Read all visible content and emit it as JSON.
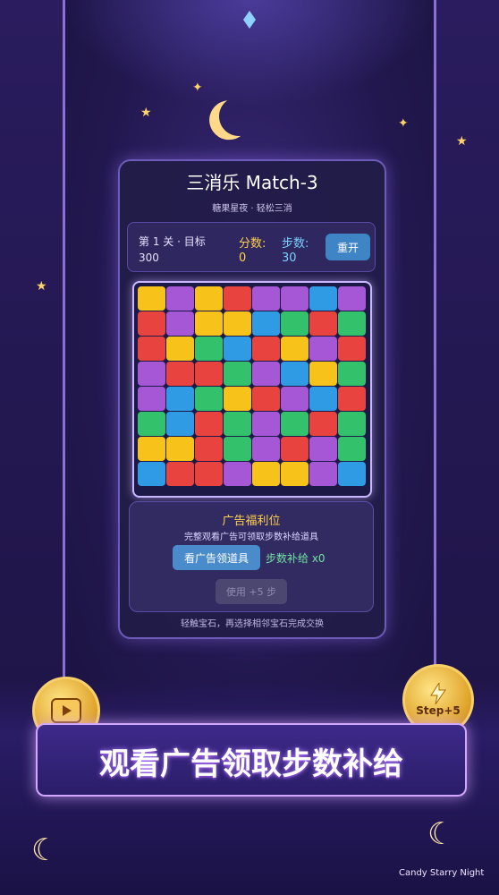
{
  "game": {
    "title": "三消乐 Match-3",
    "subtitle": "糖果星夜 · 轻松三消",
    "level_line1": "第 1 关 · 目标",
    "level_line2": "300",
    "score_label": "分数:",
    "score_value": "0",
    "steps_label": "步数:",
    "steps_value": "30",
    "restart_label": "重开",
    "hint": "轻触宝石，再选择相邻宝石完成交换"
  },
  "ad": {
    "title": "广告福利位",
    "desc": "完整观看广告可领取步数补给道具",
    "watch_button": "看广告领道具",
    "supply_text": "步数补给 x0",
    "use_button": "使用 +5 步"
  },
  "promo": {
    "banner_text": "观看广告领取步数补给",
    "coin_right_label": "Step+5",
    "brand": "Candy Starry Night"
  },
  "colors": {
    "Y": "#f7c21a",
    "P": "#a657d6",
    "R": "#e8433e",
    "B": "#2f9be5",
    "G": "#33c26b"
  },
  "board": [
    [
      "Y",
      "P",
      "Y",
      "R",
      "P",
      "P",
      "B",
      "P"
    ],
    [
      "R",
      "P",
      "Y",
      "Y",
      "B",
      "G",
      "R",
      "G"
    ],
    [
      "R",
      "Y",
      "G",
      "B",
      "R",
      "Y",
      "P",
      "R"
    ],
    [
      "P",
      "R",
      "R",
      "G",
      "P",
      "B",
      "Y",
      "G"
    ],
    [
      "P",
      "B",
      "G",
      "Y",
      "R",
      "P",
      "B",
      "R"
    ],
    [
      "G",
      "B",
      "R",
      "G",
      "P",
      "G",
      "R",
      "G"
    ],
    [
      "Y",
      "Y",
      "R",
      "G",
      "P",
      "R",
      "P",
      "G"
    ],
    [
      "B",
      "R",
      "R",
      "P",
      "Y",
      "Y",
      "P",
      "B"
    ]
  ]
}
